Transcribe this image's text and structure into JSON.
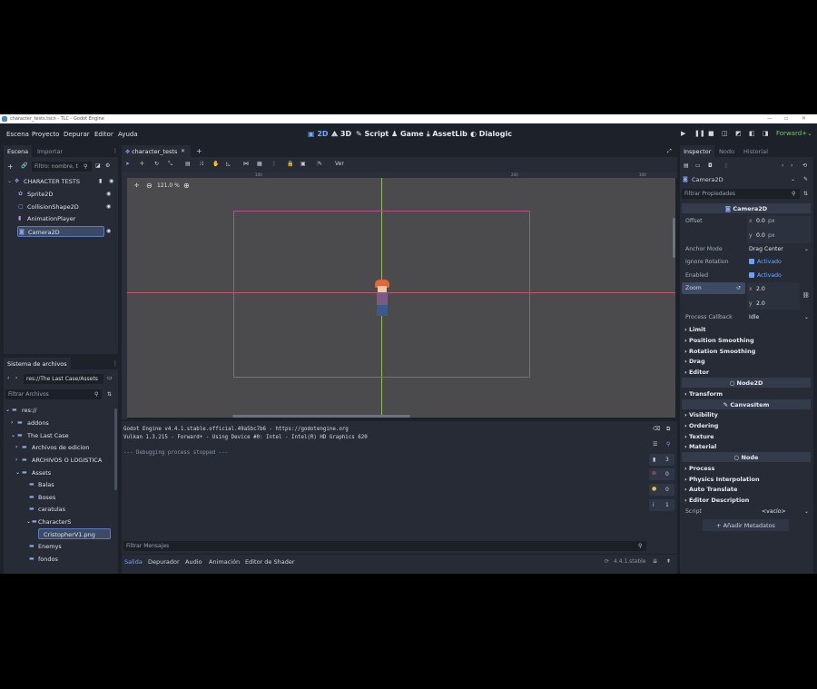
{
  "window": {
    "title": "character_tests.tscn - TLC - Godot Engine"
  },
  "menu": {
    "items": [
      "Escena",
      "Proyecto",
      "Depurar",
      "Editor",
      "Ayuda"
    ]
  },
  "workspaces": {
    "items": [
      {
        "label": "2D",
        "icon": "2d-icon"
      },
      {
        "label": "3D",
        "icon": "3d-icon"
      },
      {
        "label": "Script",
        "icon": "script-icon"
      },
      {
        "label": "Game",
        "icon": "game-icon"
      },
      {
        "label": "AssetLib",
        "icon": "assetlib-icon"
      },
      {
        "label": "Dialogic",
        "icon": "dialogic-icon"
      }
    ],
    "active": "2D"
  },
  "renderer": "Forward+",
  "scene_dock": {
    "tabs": [
      "Escena",
      "Importar"
    ],
    "filter_placeholder": "Filtro: nombre, t",
    "nodes": [
      {
        "label": "CHARACTER TESTS",
        "color": "#8da5f3"
      },
      {
        "label": "Sprite2D",
        "color": "#8da5f3"
      },
      {
        "label": "CollisionShape2D",
        "color": "#8da5f3"
      },
      {
        "label": "AnimationPlayer",
        "color": "#c38ef1"
      },
      {
        "label": "Camera2D",
        "color": "#8da5f3"
      }
    ],
    "selected": "Camera2D"
  },
  "filesystem_dock": {
    "title": "Sistema de archivos",
    "path": "res://The Last Case/Assets",
    "filter_placeholder": "Filtrar Archivos",
    "items": [
      "res://",
      "addons",
      "The Last Case",
      "Archivos de edicion",
      "ARCHIVOS O LOGISTICA",
      "Assets",
      "Balas",
      "Boses",
      "caratulas",
      "CharacterS",
      "CristopherV1.png",
      "Enemys",
      "fondos"
    ],
    "selected": "CristopherV1.png"
  },
  "viewport": {
    "tab_label": "character_tests",
    "view_menu": "Ver",
    "zoom": "121.0 %",
    "ruler_ticks": [
      "100",
      "200",
      "300"
    ]
  },
  "output": {
    "lines": [
      "Godot Engine v4.4.1.stable.official.49a5bc7b6 - https://godotengine.org",
      "Vulkan 1.3.215 - Forward+ - Using Device #0: Intel - Intel(R) HD Graphics 620",
      "",
      "--- Debugging process stopped ---"
    ],
    "filter_placeholder": "Filtrar Mensajes",
    "badges": [
      "3",
      "0",
      "0",
      "1"
    ],
    "bottom_tabs": [
      "Salida",
      "Depurador",
      "Audio",
      "Animación",
      "Editor de Shader"
    ],
    "version": "4.4.1.stable"
  },
  "inspector": {
    "tabs": [
      "Inspector",
      "Nodo",
      "Historial"
    ],
    "object": "Camera2D",
    "filter_placeholder": "Filtrar Propiedades",
    "class_header": "Camera2D",
    "offset_label": "Offset",
    "offset_x": "0.0",
    "offset_y": "0.0",
    "unit": "px",
    "anchor_mode_label": "Anchor Mode",
    "anchor_mode_value": "Drag Center",
    "ignore_rotation_label": "Ignore Rotation",
    "ignore_rotation_value": "Activado",
    "enabled_label": "Enabled",
    "enabled_value": "Activado",
    "zoom_label": "Zoom",
    "zoom_x": "2.0",
    "zoom_y": "2.0",
    "process_callback_label": "Process Callback",
    "process_callback_value": "Idle",
    "x_label": "x",
    "y_label": "y",
    "sections_camera": [
      "Limit",
      "Position Smoothing",
      "Rotation Smoothing",
      "Drag",
      "Editor"
    ],
    "node2d_header": "Node2D",
    "sections_node2d": [
      "Transform"
    ],
    "canvasitem_header": "CanvasItem",
    "sections_canvasitem": [
      "Visibility",
      "Ordering",
      "Texture",
      "Material"
    ],
    "node_header": "Node",
    "sections_node": [
      "Process",
      "Physics Interpolation",
      "Auto Translate",
      "Editor Description"
    ],
    "script_label": "Script",
    "script_value": "<vacío>",
    "add_metadata": "Añadir Metadatos"
  }
}
